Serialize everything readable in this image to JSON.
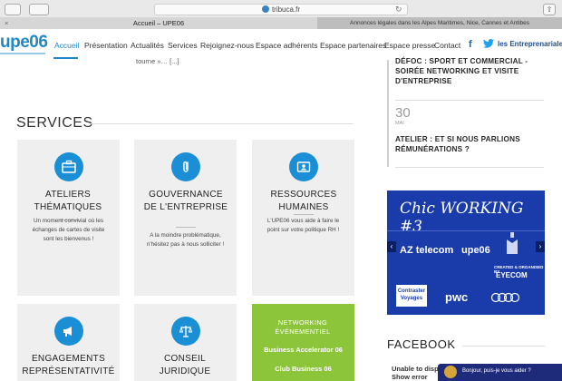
{
  "browser": {
    "url": "tribuca.fr",
    "tab_active": "Accueil – UPE06",
    "tab_other": "Annonces légales dans les Alpes Maritimes, Nice, Cannes et Antibes"
  },
  "nav": {
    "logo": "upe06",
    "items": [
      "Accueil",
      "Présentation",
      "Actualités",
      "Services",
      "Rejoignez-nous",
      "Espace adhérents",
      "Espace partenaires",
      "Espace presse",
      "Contact"
    ],
    "partner_logo": "les Entreprenariales"
  },
  "content": {
    "truncated_text": "tourne »… [...]",
    "services_title": "SERVICES"
  },
  "cards": [
    {
      "title": "ATELIERS THÉMATIQUES",
      "desc": "Un moment convivial où les échanges de cartes de visite sont les bienvenus !",
      "icon": "briefcase-icon"
    },
    {
      "title": "GOUVERNANCE DE L'ENTREPRISE",
      "desc": "A la moindre problématique, n'hésitez pas à nous solliciter !",
      "icon": "paperclip-icon"
    },
    {
      "title": "RESSOURCES HUMAINES",
      "desc": "L'UPE06 vous aide à faire le point sur votre politique RH !",
      "icon": "id-card-icon"
    },
    {
      "title": "ENGAGEMENTS REPRÉSENTATIVITÉ",
      "icon": "megaphone-icon"
    },
    {
      "title": "CONSEIL JURIDIQUE",
      "icon": "scales-icon"
    }
  ],
  "networking": {
    "title": "NETWORKING ÉVÉNEMENTIEL",
    "links": [
      "Business Accelerator 06",
      "Club Business 06"
    ]
  },
  "sidebar": {
    "event1_lines": [
      "DÉFOC : SPORT ET COMMERCIAL -",
      "SOIRÉE NETWORKING ET VISITE",
      "D'ENTREPRISE"
    ],
    "event2_day": "30",
    "event2_month": "MAI",
    "event2_lines": [
      "ATELIER : ET SI NOUS PARLIONS",
      "RÉMUNÉRATIONS ?"
    ],
    "banner": {
      "title": "Chic WORKING #3",
      "logo_az": "AZ telecom",
      "logo_upe": "upe06",
      "created_by": "CREATED & ORGANISED BY",
      "eyecom": "EYECOM",
      "contraster": "Contraster Voyages",
      "pwc": "pwc"
    },
    "facebook_title": "FACEBOOK",
    "facebook_lines": [
      "Unable to display",
      "Show error"
    ]
  },
  "chat": {
    "message": "Bonjour, puis-je vous aider ?"
  }
}
